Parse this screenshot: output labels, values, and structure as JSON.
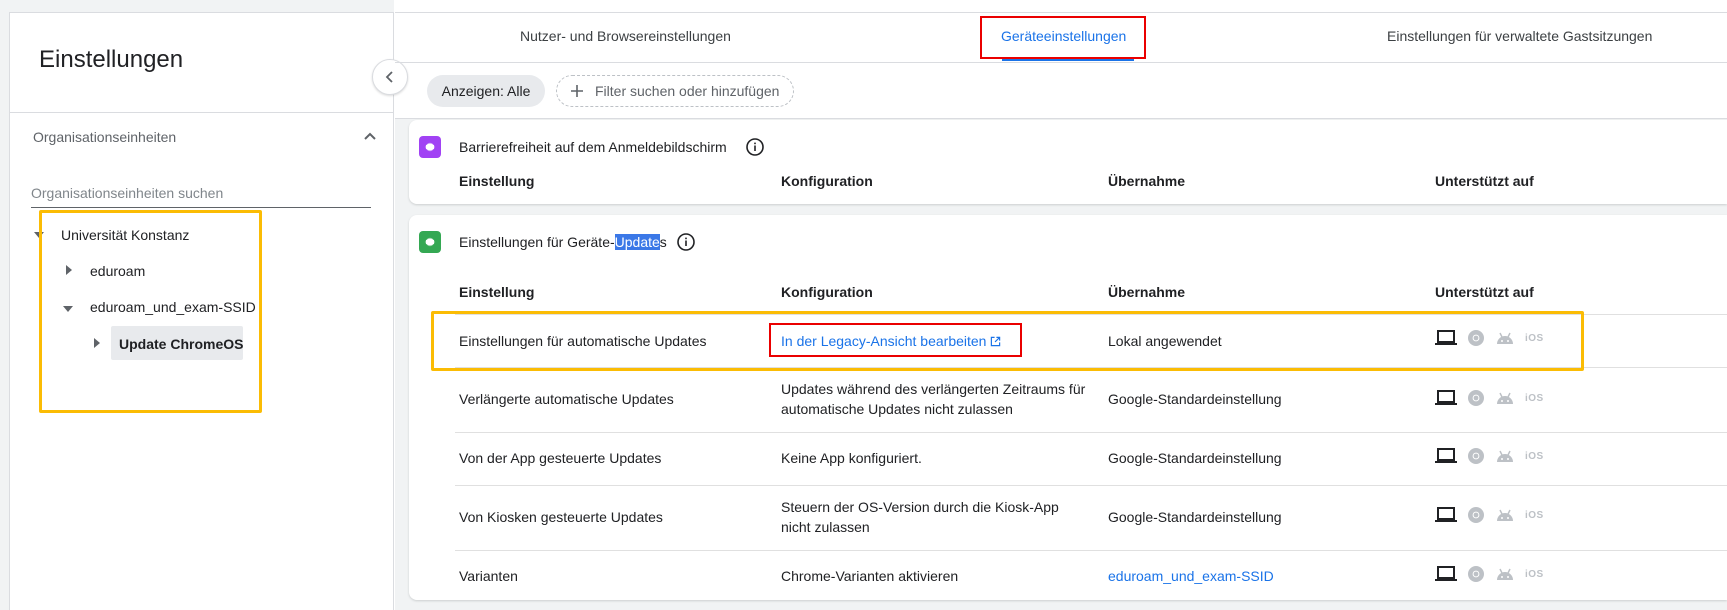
{
  "sidebar": {
    "title": "Einstellungen",
    "org_units_label": "Organisationseinheiten",
    "search_placeholder": "Organisationseinheiten suchen",
    "tree": {
      "root": "Universität Konstanz",
      "child1": "eduroam",
      "child2": "eduroam_und_exam-SSID",
      "grandchild": "Update ChromeOS"
    }
  },
  "tabs": {
    "tab1": "Nutzer- und Browsereinstellungen",
    "tab2": "Geräteeinstellungen",
    "tab3": "Einstellungen für verwaltete Gastsitzungen"
  },
  "filters": {
    "show_label": "Anzeigen: Alle",
    "filter_placeholder": "Filter suchen oder hinzufügen"
  },
  "section1": {
    "title": "Barrierefreiheit auf dem Anmeldebildschirm"
  },
  "section2": {
    "title_prefix": "Einstellungen für Geräte-",
    "title_highlight": "Update",
    "title_suffix": "s"
  },
  "headers": {
    "setting": "Einstellung",
    "config": "Konfiguration",
    "inheritance": "Übernahme",
    "supported": "Unterstützt auf"
  },
  "rows": [
    {
      "setting": "Einstellungen für automatische Updates",
      "config": "In der Legacy-Ansicht bearbeiten",
      "inheritance": "Lokal angewendet"
    },
    {
      "setting": "Verlängerte automatische Updates",
      "config": "Updates während des verlängerten Zeitraums für automatische Updates nicht zulassen",
      "inheritance": "Google-Standardeinstellung"
    },
    {
      "setting": "Von der App gesteuerte Updates",
      "config": "Keine App konfiguriert.",
      "inheritance": "Google-Standardeinstellung"
    },
    {
      "setting": "Von Kiosken gesteuerte Updates",
      "config": "Steuern der OS-Version durch die Kiosk-App nicht zulassen",
      "inheritance": "Google-Standardeinstellung"
    },
    {
      "setting": "Varianten",
      "config": "Chrome-Varianten aktivieren",
      "inheritance": "eduroam_und_exam-SSID"
    }
  ],
  "platform_ios": "iOS",
  "colors": {
    "accent": "#1a73e8",
    "section1_icon": "#a142f4",
    "section2_icon": "#34a853",
    "highlight_yellow": "#fbbc04",
    "highlight_red": "#ea0000"
  }
}
